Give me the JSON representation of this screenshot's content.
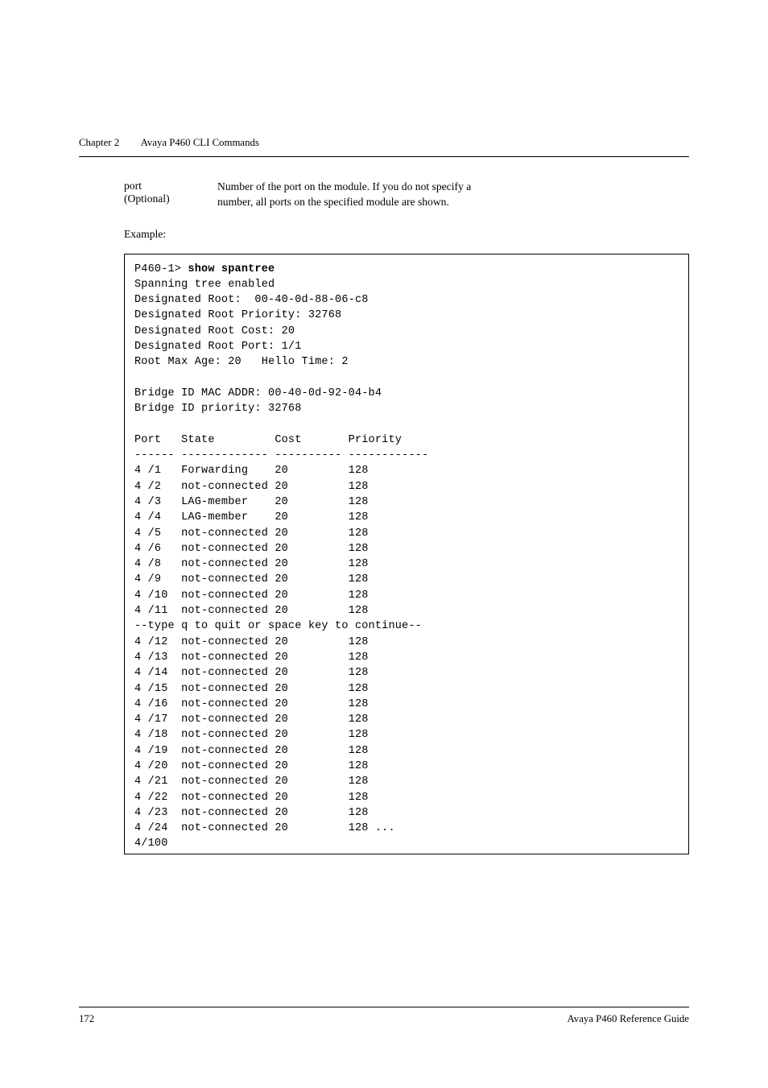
{
  "header": {
    "chapter_label": "Chapter 2",
    "chapter_title": "Avaya P460 CLI Commands"
  },
  "param": {
    "name_line1": "port",
    "name_line2": "(Optional)",
    "desc_line1": "Number of the port on the module. If you do not specify a",
    "desc_line2": "number, all ports on the specified module are shown."
  },
  "example_label": "Example:",
  "cli": {
    "prompt": "P460-1> ",
    "command": "show spantree",
    "header_lines": [
      "Spanning tree enabled",
      "Designated Root:  00-40-0d-88-06-c8",
      "Designated Root Priority: 32768",
      "Designated Root Cost: 20",
      "Designated Root Port: 1/1",
      "Root Max Age: 20   Hello Time: 2",
      "",
      "Bridge ID MAC ADDR: 00-40-0d-92-04-b4",
      "Bridge ID priority: 32768",
      ""
    ],
    "table_header": "Port   State         Cost       Priority",
    "table_rule": "------ ------------- ---------- ------------",
    "rows_block1": [
      "4 /1   Forwarding    20         128",
      "4 /2   not-connected 20         128",
      "4 /3   LAG-member    20         128",
      "4 /4   LAG-member    20         128",
      "4 /5   not-connected 20         128",
      "4 /6   not-connected 20         128",
      "4 /8   not-connected 20         128",
      "4 /9   not-connected 20         128",
      "4 /10  not-connected 20         128",
      "4 /11  not-connected 20         128"
    ],
    "continue_line": "--type q to quit or space key to continue--",
    "rows_block2": [
      "4 /12  not-connected 20         128",
      "4 /13  not-connected 20         128",
      "4 /14  not-connected 20         128",
      "4 /15  not-connected 20         128",
      "4 /16  not-connected 20         128",
      "4 /17  not-connected 20         128",
      "4 /18  not-connected 20         128",
      "4 /19  not-connected 20         128",
      "4 /20  not-connected 20         128",
      "4 /21  not-connected 20         128",
      "4 /22  not-connected 20         128",
      "4 /23  not-connected 20         128",
      "4 /24  not-connected 20         128 ...",
      "4/100"
    ]
  },
  "footer": {
    "page_number": "172",
    "book_title": "Avaya P460 Reference Guide"
  }
}
